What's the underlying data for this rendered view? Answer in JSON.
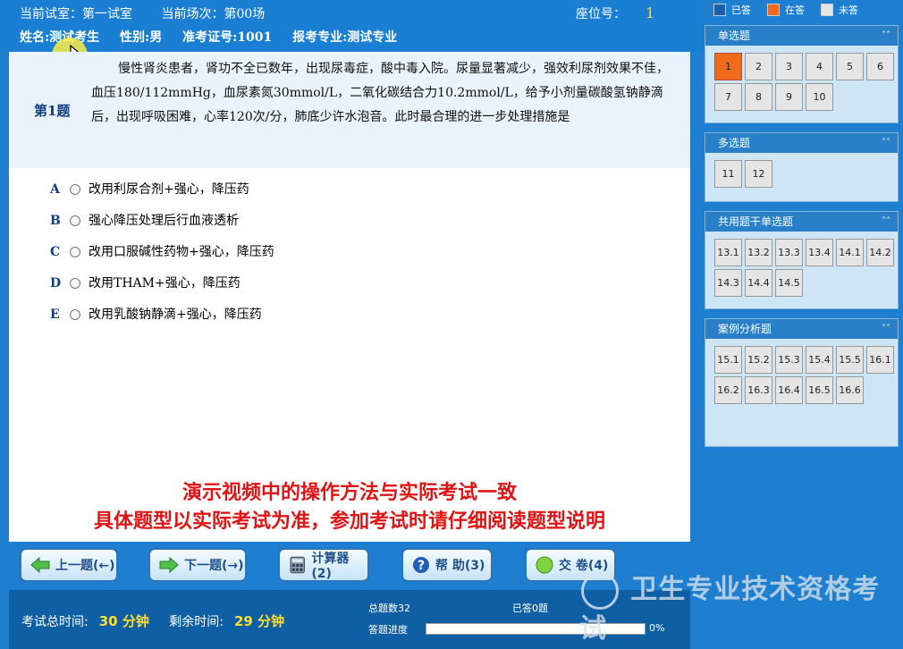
{
  "header": {
    "room": "当前试室：第一试室",
    "session": "当前场次：第00场",
    "seat_label": "座位号：",
    "seat_value": "1",
    "name": "姓名:测试考生",
    "gender": "性别:男",
    "ticket": "准考证号:1001",
    "major": "报考专业:测试专业"
  },
  "question": {
    "number": "第1题",
    "text": "慢性肾炎患者，肾功不全已数年，出现尿毒症，酸中毒入院。尿量显著减少，强效利尿剂效果不佳，血压180/112mmHg，血尿素氮30mmol/L，二氧化碳结合力10.2mmol/L，给予小剂量碳酸氢钠静滴后，出现呼吸困难，心率120次/分，肺底少许水泡音。此时最合理的进一步处理措施是",
    "options": [
      {
        "letter": "A",
        "text": "改用利尿合剂+强心，降压药"
      },
      {
        "letter": "B",
        "text": "强心降压处理后行血液透析"
      },
      {
        "letter": "C",
        "text": "改用口服碱性药物+强心，降压药"
      },
      {
        "letter": "D",
        "text": "改用THAM+强心，降压药"
      },
      {
        "letter": "E",
        "text": "改用乳酸钠静滴+强心，降压药"
      }
    ]
  },
  "notice": {
    "line1": "演示视频中的操作方法与实际考试一致",
    "line2": "具体题型以实际考试为准，参加考试时请仔细阅读题型说明"
  },
  "buttons": {
    "prev": "上一题(←)",
    "next": "下一题(→)",
    "calc": "计算器(2)",
    "help": "帮  助(3)",
    "submit": "交  卷(4)"
  },
  "footer": {
    "total_label": "考试总时间:",
    "total_value": "30 分钟",
    "remain_label": "剩余时间:",
    "remain_value": "29 分钟",
    "count": "总题数32",
    "answered": "已答0题",
    "progress_label": "答题进度",
    "progress_pct": "0%",
    "progress_value": 0
  },
  "watermark": "卫生专业技术资格考试",
  "legend": {
    "answered": "已答",
    "current": "在答",
    "unanswered": "未答"
  },
  "sections": [
    {
      "title": "单选题",
      "items": [
        "1",
        "2",
        "3",
        "4",
        "5",
        "6",
        "7",
        "8",
        "9",
        "10"
      ]
    },
    {
      "title": "多选题",
      "items": [
        "11",
        "12"
      ]
    },
    {
      "title": "共用题干单选题",
      "items": [
        "13.1",
        "13.2",
        "13.3",
        "13.4",
        "14.1",
        "14.2",
        "14.3",
        "14.4",
        "14.5"
      ]
    },
    {
      "title": "案例分析题",
      "items": [
        "15.1",
        "15.2",
        "15.3",
        "15.4",
        "15.5",
        "16.1",
        "16.2",
        "16.3",
        "16.4",
        "16.5",
        "16.6"
      ]
    }
  ],
  "colors": {
    "answered": "#1b5fb0",
    "current": "#f06a1c",
    "unanswered": "#e5e5e5"
  }
}
